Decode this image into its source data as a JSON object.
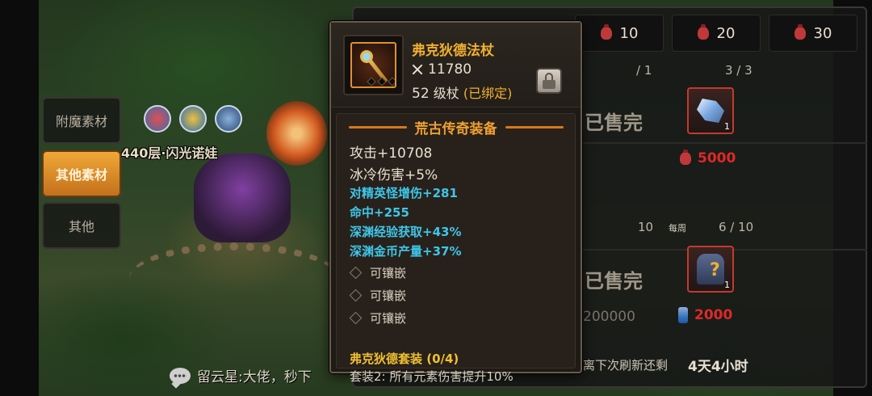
{
  "background": {
    "player_name": "440层·闪光诺娃",
    "chat": {
      "text": "留云星:大佬，秒下"
    }
  },
  "side_tabs": [
    {
      "label": "附魔素材",
      "active": false
    },
    {
      "label": "其他素材",
      "active": true
    },
    {
      "label": "其他",
      "active": false
    }
  ],
  "shop": {
    "price_boxes": [
      "10",
      "20",
      "30"
    ],
    "row1": {
      "slot_a": {
        "count": "/ 1",
        "status": "已售完"
      },
      "slot_b": {
        "count": "3 / 3",
        "qty": "1",
        "price": "5000"
      }
    },
    "row2": {
      "weekly_label": "每周",
      "slot_a": {
        "count": "10",
        "status": "已售完",
        "price": "200000"
      },
      "slot_b": {
        "count": "6 / 10",
        "qty": "1",
        "price": "2000"
      }
    },
    "refresh_label": "离下次刷新还剩",
    "refresh_time": "4天4小时"
  },
  "tooltip": {
    "item_name": "弗克狄德法杖",
    "power": "11780",
    "level": "52",
    "level_suffix": "级杖",
    "bound": "(已绑定)",
    "section_title": "荒古传奇装备",
    "base_stats": [
      "攻击+10708",
      "冰冷伤害+5%"
    ],
    "bonus_stats": [
      "对精英怪增伤+281",
      "命中+255",
      "深渊经验获取+43%",
      "深渊金币产量+37%"
    ],
    "sockets": [
      "可镶嵌",
      "可镶嵌",
      "可镶嵌"
    ],
    "set_name": "弗克狄德套装 (0/4)",
    "set_bonus": "套装2: 所有元素伤害提升10%"
  },
  "colors": {
    "legendary_gold": "#f0b030",
    "bonus_cyan": "#3ec6e8",
    "price_red": "#e02828",
    "tab_active": "#e8962c"
  },
  "icons": [
    "swords-icon",
    "lock-icon",
    "chat-icon",
    "bag-icon",
    "potion-icon",
    "staff-item-icon",
    "crystal-item-icon",
    "mystery-item-icon"
  ]
}
